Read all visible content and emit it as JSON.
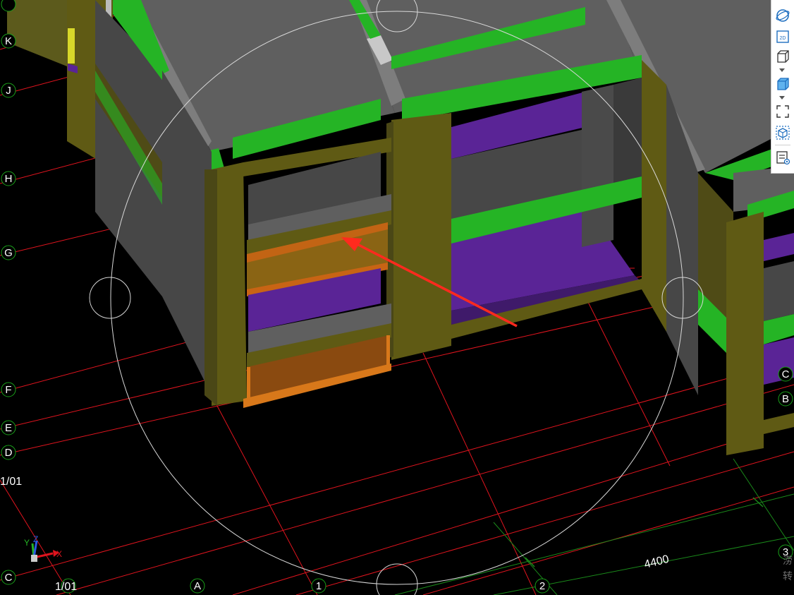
{
  "grid_axes": {
    "rows": [
      "K",
      "J",
      "H",
      "G",
      "F",
      "E",
      "D",
      "C"
    ],
    "columns": [
      "A",
      "1",
      "2",
      "3",
      "B",
      "C"
    ],
    "partial_row_label": "1/01",
    "partial_col_label": "1/01"
  },
  "dimension": {
    "value": "4400"
  },
  "ucs": {
    "x_label": "X",
    "y_label": "Y",
    "z_label": "Z"
  },
  "right_edge_text": [
    "涝",
    "转"
  ],
  "toolbar": {
    "items": [
      {
        "name": "orbit",
        "icon": "orbit-sphere-icon"
      },
      {
        "name": "2d-view",
        "icon": "2d-view-icon",
        "label": "2D"
      },
      {
        "name": "3d-wireframe",
        "icon": "wireframe-cube-icon"
      },
      {
        "name": "3d-shaded",
        "icon": "shaded-cube-icon"
      },
      {
        "name": "zoom-extents",
        "icon": "zoom-extents-icon"
      },
      {
        "name": "view-cube",
        "icon": "view-cube-icon"
      },
      {
        "name": "properties",
        "icon": "properties-panel-icon"
      }
    ]
  },
  "colors": {
    "background": "#000000",
    "grid_line": "#e0141e",
    "grid_line_alt": "#1a8a1a",
    "axis_circle": "#19a019",
    "slab_top": "#5f5f5f",
    "beam_green": "#25b425",
    "column_olive": "#5f5a14",
    "wall_gray": "#4a4a4a",
    "purple_slab": "#5a2496",
    "orange_selected": "#c86414",
    "arrow_red": "#ff2a1e",
    "orbit_ring": "#d8d8d8"
  }
}
